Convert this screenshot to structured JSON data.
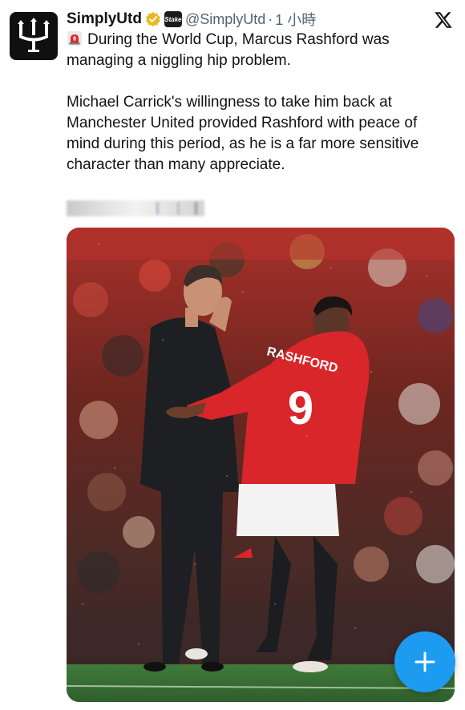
{
  "author": {
    "display_name": "SimplyUtd",
    "affiliate_badge_text": "Stake",
    "handle": "@SimplyUtd",
    "separator": "·",
    "time": "1 小時"
  },
  "tweet": {
    "paragraph_1": "During the World Cup, Marcus Rashford was managing a niggling hip problem.",
    "paragraph_2": "Michael Carrick's willingness to take him back at Manchester United provided Rashford with peace of mind during this period, as he is a far more sensitive character than many appreciate."
  },
  "media": {
    "shirt_name": "RASHFORD",
    "shirt_number": "9"
  },
  "colors": {
    "accent_blue": "#1d9bf0",
    "text_primary": "#0f1419",
    "text_secondary": "#536471",
    "shirt_red": "#d8262a"
  },
  "icons": {
    "avatar": "trident-logo-icon",
    "verified": "verified-badge-icon",
    "close": "x-logo-icon",
    "siren": "siren-emoji-icon",
    "compose": "plus-icon"
  }
}
